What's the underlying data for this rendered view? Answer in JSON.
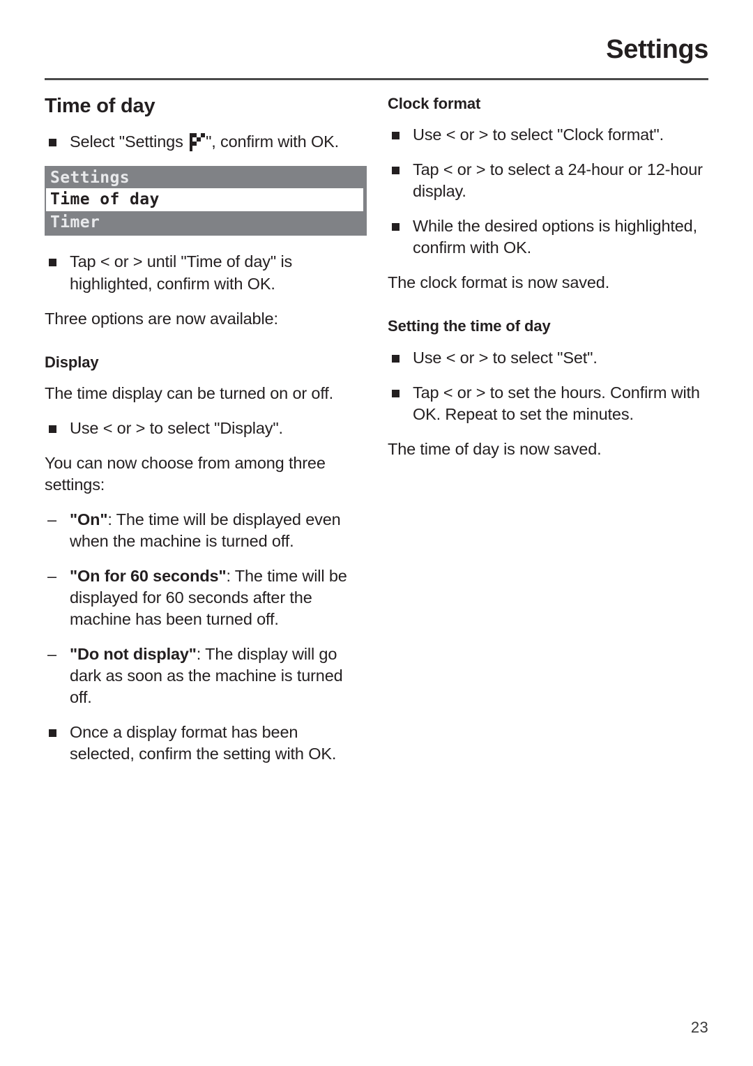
{
  "header": {
    "title": "Settings",
    "rule_color": "#4a4a4a"
  },
  "page_number": "23",
  "left_column": {
    "section_title": "Time of day",
    "bullet_select_settings_pre": "Select \"Settings ",
    "bullet_select_settings_post": "\", confirm with OK.",
    "lcd": {
      "title": "Settings",
      "selected_item": "Time of day",
      "item2": "Timer",
      "bg_color": "#808286",
      "text_color": "#e9eaec",
      "highlight_bg": "#ffffff",
      "highlight_text": "#231f20"
    },
    "bullet_tap_until": "Tap < or > until \"Time of day\" is highlighted, confirm with OK.",
    "para_three_options": "Three options are now available:",
    "display_heading": "Display",
    "para_display_onoff": "The time display can be turned on or off.",
    "bullet_use_select_display": "Use < or > to select \"Display\".",
    "para_choose_three": "You can now choose from among three settings:",
    "dash_on_bold": "\"On\"",
    "dash_on_rest": ": The time will be displayed even when the machine is turned off.",
    "dash_on60_bold": "\"On for 60 seconds\"",
    "dash_on60_rest": ": The time will be displayed for 60 seconds after the machine has been turned off.",
    "dash_donot_bold": "\"Do not display\"",
    "dash_donot_rest": ": The display will go dark as soon as the machine is turned off.",
    "bullet_once_selected": "Once a display format has been selected, confirm the setting with OK."
  },
  "right_column": {
    "clock_format_heading": "Clock format",
    "bullet_use_select_clock": "Use < or > to select \"Clock format\".",
    "bullet_tap_24_12": "Tap < or > to select a 24-hour or 12-hour display.",
    "bullet_while_highlighted": "While the desired options is highlighted, confirm with OK.",
    "para_clock_saved": "The clock format is now saved.",
    "setting_time_heading": "Setting the time of day",
    "bullet_use_select_set": "Use < or > to select \"Set\".",
    "bullet_tap_hours": "Tap < or > to set the hours. Confirm with OK. Repeat to set the minutes.",
    "para_time_saved": "The time of day is now saved."
  },
  "icons": {
    "settings_flag": "settings-flag-icon"
  }
}
